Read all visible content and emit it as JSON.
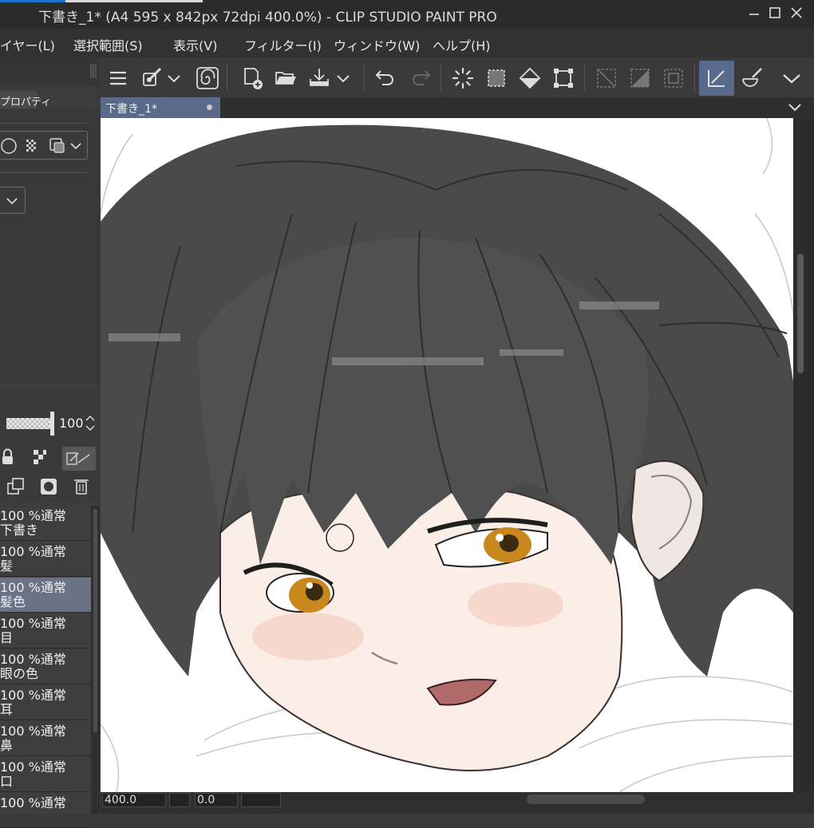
{
  "window": {
    "title": "下書き_1* (A4 595 x 842px 72dpi 400.0%)  - CLIP STUDIO PAINT PRO",
    "controls": [
      "minimize-icon",
      "maximize-icon",
      "close-icon"
    ]
  },
  "menu": [
    "イヤー(L)",
    "選択範囲(S)",
    "表示(V)",
    "フィルター(I)",
    "ウィンドウ(W)",
    "ヘルプ(H)"
  ],
  "toolbar": {
    "tools": [
      "menu-icon",
      "brush-settings-icon",
      "chevron-down-icon",
      "spiral-icon",
      "new-canvas-icon",
      "open-folder-icon",
      "save-icon",
      "chevron-down-icon",
      "undo-icon",
      "redo-icon",
      "select-loading-icon",
      "select-all-icon",
      "fill-icon",
      "transform-icon",
      "clear-selection-icon",
      "invert-selection-icon",
      "deselect-icon",
      "correct-line-icon",
      "brush-icon",
      "chevron-down-icon"
    ],
    "active_tool": "correct-line-icon"
  },
  "document_tab": {
    "label": "下書き_1*"
  },
  "property_panel": {
    "tab_label": "プロパティ"
  },
  "layer_panel": {
    "opacity": "100",
    "layers": [
      {
        "mode": "100 %通常",
        "name": "下書き",
        "selected": false
      },
      {
        "mode": "100 %通常",
        "name": "髪",
        "selected": false
      },
      {
        "mode": "100 %通常",
        "name": "髪色",
        "selected": true
      },
      {
        "mode": "100 %通常",
        "name": "目",
        "selected": false
      },
      {
        "mode": "100 %通常",
        "name": "眼の色",
        "selected": false
      },
      {
        "mode": "100 %通常",
        "name": "耳",
        "selected": false
      },
      {
        "mode": "100 %通常",
        "name": "鼻",
        "selected": false
      },
      {
        "mode": "100 %通常",
        "name": "口",
        "selected": false
      },
      {
        "mode": "100 %通常",
        "name": "",
        "selected": false
      }
    ]
  },
  "status": {
    "zoom": "400.0",
    "rotation": "0.0"
  },
  "colors": {
    "accent": "#586a8c",
    "selected_layer": "#6b7286",
    "hair": "#4a4a4a",
    "iris": "#c8881e",
    "lips": "#b06a6a",
    "skin": "#fbeee6"
  }
}
